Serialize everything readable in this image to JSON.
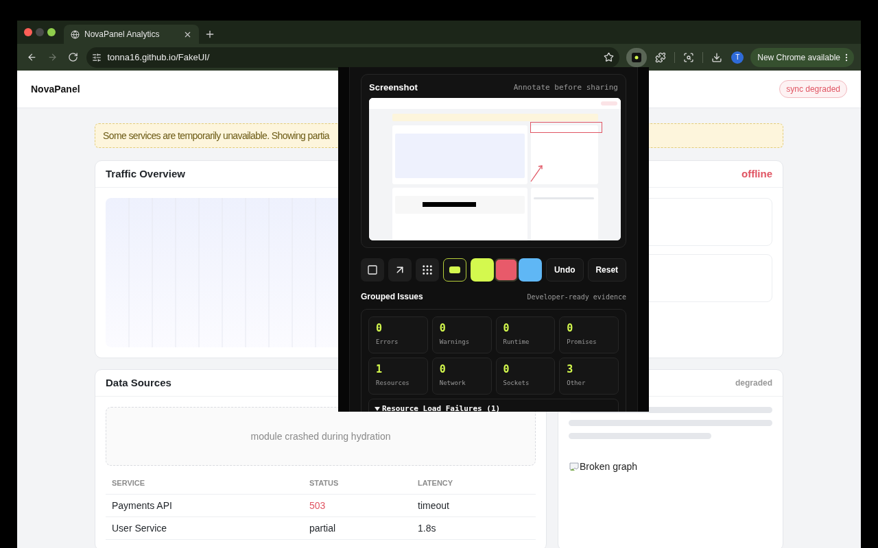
{
  "browser": {
    "tabs": [
      {
        "title": "NovaPanel Analytics",
        "selected": true
      }
    ],
    "nav": [
      {
        "kind": "back",
        "disabled": false
      },
      {
        "kind": "forward",
        "disabled": true
      },
      {
        "kind": "reload",
        "disabled": false
      }
    ],
    "url": "tonna16.github.io/FakeUI/",
    "extension_active": true,
    "avatar": "T",
    "update_button": "New Chrome available"
  },
  "page": {
    "brand": "NovaPanel",
    "badge": "sync degraded",
    "alert": "Some services are temporarily unavailable. Showing partia",
    "traffic": {
      "title": "Traffic Overview"
    },
    "live": {
      "status": "offline"
    },
    "sources": {
      "title": "Data Sources",
      "crash": "module crashed during hydration",
      "columns": [
        "SERVICE",
        "STATUS",
        "LATENCY"
      ],
      "rows": [
        {
          "service": "Payments API",
          "status": "503",
          "color": "#e05563",
          "latency": "timeout"
        },
        {
          "service": "User Service",
          "status": "partial",
          "color": "#1f2328",
          "latency": "1.8s"
        }
      ]
    },
    "ops": {
      "status": "degraded",
      "image_alt": "Broken graph"
    }
  },
  "popup": {
    "screenshot": {
      "title": "Screenshot",
      "hint": "Annotate before sharing",
      "annotations": [
        {
          "kind": "rect"
        },
        {
          "kind": "arrow"
        }
      ]
    },
    "tools": [
      {
        "kind": "rect",
        "selected": false
      },
      {
        "kind": "arrow",
        "selected": false
      },
      {
        "kind": "blur",
        "selected": false
      },
      {
        "kind": "highlight",
        "selected": true
      }
    ],
    "colors": [
      {
        "color": "#d4f94e",
        "selected": false
      },
      {
        "color": "#e85a6a",
        "selected": true
      },
      {
        "color": "#5fb7f5",
        "selected": false
      }
    ],
    "actions": [
      "Undo",
      "Reset"
    ],
    "issues": {
      "title": "Grouped Issues",
      "hint": "Developer-ready evidence",
      "stats": [
        {
          "value": "0",
          "label": "Errors"
        },
        {
          "value": "0",
          "label": "Warnings"
        },
        {
          "value": "0",
          "label": "Runtime"
        },
        {
          "value": "0",
          "label": "Promises"
        },
        {
          "value": "1",
          "label": "Resources"
        },
        {
          "value": "0",
          "label": "Network"
        },
        {
          "value": "0",
          "label": "Sockets"
        },
        {
          "value": "3",
          "label": "Other"
        }
      ],
      "groups": [
        {
          "title": "Resource Load Failures (1)",
          "expanded": true
        }
      ]
    }
  }
}
